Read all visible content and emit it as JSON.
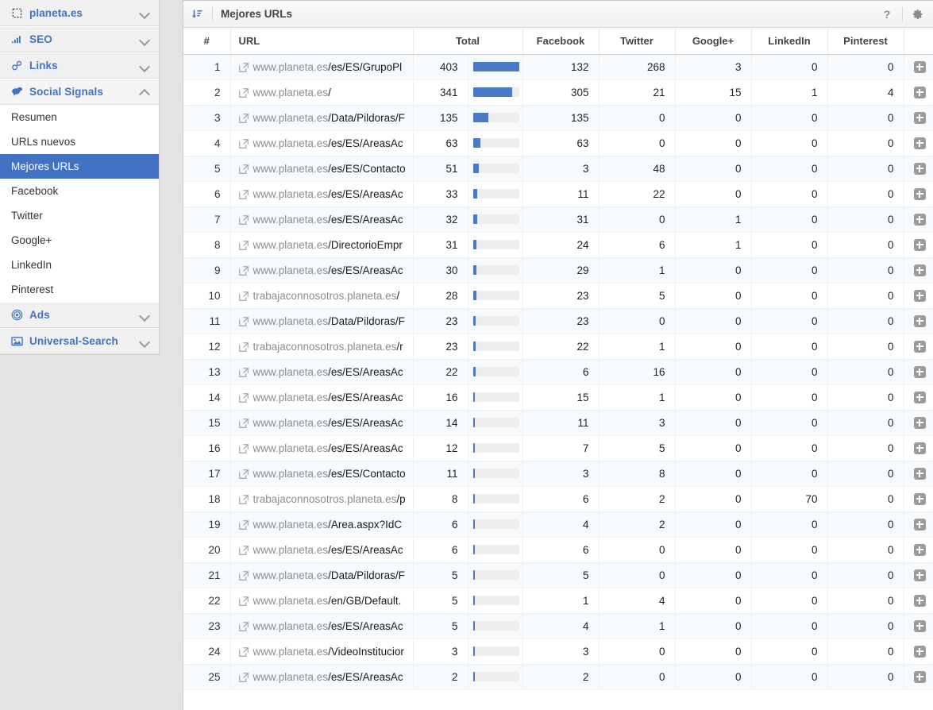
{
  "sidebar": {
    "groups": [
      {
        "label": "planeta.es",
        "icon": "dashed-square-icon",
        "expanded": false
      },
      {
        "label": "SEO",
        "icon": "bar-chart-icon",
        "expanded": false
      },
      {
        "label": "Links",
        "icon": "chain-link-icon",
        "expanded": false
      },
      {
        "label": "Social Signals",
        "icon": "speech-bubbles-icon",
        "expanded": true
      },
      {
        "label": "Ads",
        "icon": "bullseye-icon",
        "expanded": false
      },
      {
        "label": "Universal-Search",
        "icon": "image-icon",
        "expanded": false
      }
    ],
    "social_items": [
      {
        "label": "Resumen",
        "active": false
      },
      {
        "label": "URLs nuevos",
        "active": false
      },
      {
        "label": "Mejores URLs",
        "active": true
      },
      {
        "label": "Facebook",
        "active": false
      },
      {
        "label": "Twitter",
        "active": false
      },
      {
        "label": "Google+",
        "active": false
      },
      {
        "label": "LinkedIn",
        "active": false
      },
      {
        "label": "Pinterest",
        "active": false
      }
    ]
  },
  "panel": {
    "title": "Mejores URLs",
    "sort_icon": "sort-descending-icon",
    "help_label": "?",
    "settings_icon": "gear-icon"
  },
  "table": {
    "columns": [
      "#",
      "URL",
      "Total",
      "Facebook",
      "Twitter",
      "Google+",
      "LinkedIn",
      "Pinterest"
    ],
    "max_total": 403,
    "rows": [
      {
        "rank": "1",
        "domain": "www.planeta.es",
        "path": "/es/ES/GrupoPl",
        "total": "403",
        "facebook": "132",
        "twitter": "268",
        "googleplus": "3",
        "linkedin": "0",
        "pinterest": "0"
      },
      {
        "rank": "2",
        "domain": "www.planeta.es",
        "path": "/",
        "total": "341",
        "facebook": "305",
        "twitter": "21",
        "googleplus": "15",
        "linkedin": "1",
        "pinterest": "4"
      },
      {
        "rank": "3",
        "domain": "www.planeta.es",
        "path": "/Data/Pildoras/F",
        "total": "135",
        "facebook": "135",
        "twitter": "0",
        "googleplus": "0",
        "linkedin": "0",
        "pinterest": "0"
      },
      {
        "rank": "4",
        "domain": "www.planeta.es",
        "path": "/es/ES/AreasAc",
        "total": "63",
        "facebook": "63",
        "twitter": "0",
        "googleplus": "0",
        "linkedin": "0",
        "pinterest": "0"
      },
      {
        "rank": "5",
        "domain": "www.planeta.es",
        "path": "/es/ES/Contacto",
        "total": "51",
        "facebook": "3",
        "twitter": "48",
        "googleplus": "0",
        "linkedin": "0",
        "pinterest": "0"
      },
      {
        "rank": "6",
        "domain": "www.planeta.es",
        "path": "/es/ES/AreasAc",
        "total": "33",
        "facebook": "11",
        "twitter": "22",
        "googleplus": "0",
        "linkedin": "0",
        "pinterest": "0"
      },
      {
        "rank": "7",
        "domain": "www.planeta.es",
        "path": "/es/ES/AreasAc",
        "total": "32",
        "facebook": "31",
        "twitter": "0",
        "googleplus": "1",
        "linkedin": "0",
        "pinterest": "0"
      },
      {
        "rank": "8",
        "domain": "www.planeta.es",
        "path": "/DirectorioEmpr",
        "total": "31",
        "facebook": "24",
        "twitter": "6",
        "googleplus": "1",
        "linkedin": "0",
        "pinterest": "0"
      },
      {
        "rank": "9",
        "domain": "www.planeta.es",
        "path": "/es/ES/AreasAc",
        "total": "30",
        "facebook": "29",
        "twitter": "1",
        "googleplus": "0",
        "linkedin": "0",
        "pinterest": "0"
      },
      {
        "rank": "10",
        "domain": "trabajaconnosotros.planeta.es",
        "path": "/",
        "total": "28",
        "facebook": "23",
        "twitter": "5",
        "googleplus": "0",
        "linkedin": "0",
        "pinterest": "0"
      },
      {
        "rank": "11",
        "domain": "www.planeta.es",
        "path": "/Data/Pildoras/F",
        "total": "23",
        "facebook": "23",
        "twitter": "0",
        "googleplus": "0",
        "linkedin": "0",
        "pinterest": "0"
      },
      {
        "rank": "12",
        "domain": "trabajaconnosotros.planeta.es",
        "path": "/r",
        "total": "23",
        "facebook": "22",
        "twitter": "1",
        "googleplus": "0",
        "linkedin": "0",
        "pinterest": "0"
      },
      {
        "rank": "13",
        "domain": "www.planeta.es",
        "path": "/es/ES/AreasAc",
        "total": "22",
        "facebook": "6",
        "twitter": "16",
        "googleplus": "0",
        "linkedin": "0",
        "pinterest": "0"
      },
      {
        "rank": "14",
        "domain": "www.planeta.es",
        "path": "/es/ES/AreasAc",
        "total": "16",
        "facebook": "15",
        "twitter": "1",
        "googleplus": "0",
        "linkedin": "0",
        "pinterest": "0"
      },
      {
        "rank": "15",
        "domain": "www.planeta.es",
        "path": "/es/ES/AreasAc",
        "total": "14",
        "facebook": "11",
        "twitter": "3",
        "googleplus": "0",
        "linkedin": "0",
        "pinterest": "0"
      },
      {
        "rank": "16",
        "domain": "www.planeta.es",
        "path": "/es/ES/AreasAc",
        "total": "12",
        "facebook": "7",
        "twitter": "5",
        "googleplus": "0",
        "linkedin": "0",
        "pinterest": "0"
      },
      {
        "rank": "17",
        "domain": "www.planeta.es",
        "path": "/es/ES/Contacto",
        "total": "11",
        "facebook": "3",
        "twitter": "8",
        "googleplus": "0",
        "linkedin": "0",
        "pinterest": "0"
      },
      {
        "rank": "18",
        "domain": "trabajaconnosotros.planeta.es",
        "path": "/p",
        "total": "8",
        "facebook": "6",
        "twitter": "2",
        "googleplus": "0",
        "linkedin": "70",
        "pinterest": "0"
      },
      {
        "rank": "19",
        "domain": "www.planeta.es",
        "path": "/Area.aspx?IdC",
        "total": "6",
        "facebook": "4",
        "twitter": "2",
        "googleplus": "0",
        "linkedin": "0",
        "pinterest": "0"
      },
      {
        "rank": "20",
        "domain": "www.planeta.es",
        "path": "/es/ES/AreasAc",
        "total": "6",
        "facebook": "6",
        "twitter": "0",
        "googleplus": "0",
        "linkedin": "0",
        "pinterest": "0"
      },
      {
        "rank": "21",
        "domain": "www.planeta.es",
        "path": "/Data/Pildoras/F",
        "total": "5",
        "facebook": "5",
        "twitter": "0",
        "googleplus": "0",
        "linkedin": "0",
        "pinterest": "0"
      },
      {
        "rank": "22",
        "domain": "www.planeta.es",
        "path": "/en/GB/Default.",
        "total": "5",
        "facebook": "1",
        "twitter": "4",
        "googleplus": "0",
        "linkedin": "0",
        "pinterest": "0"
      },
      {
        "rank": "23",
        "domain": "www.planeta.es",
        "path": "/es/ES/AreasAc",
        "total": "5",
        "facebook": "4",
        "twitter": "1",
        "googleplus": "0",
        "linkedin": "0",
        "pinterest": "0"
      },
      {
        "rank": "24",
        "domain": "www.planeta.es",
        "path": "/VideoInstitucior",
        "total": "3",
        "facebook": "3",
        "twitter": "0",
        "googleplus": "0",
        "linkedin": "0",
        "pinterest": "0"
      },
      {
        "rank": "25",
        "domain": "www.planeta.es",
        "path": "/es/ES/AreasAc",
        "total": "2",
        "facebook": "2",
        "twitter": "0",
        "googleplus": "0",
        "linkedin": "0",
        "pinterest": "0"
      }
    ]
  },
  "colors": {
    "accent": "#4272c4",
    "bar": "#4a7ac7",
    "row_stripe": "#f6fafd",
    "page_bg": "#e3e3e3"
  }
}
